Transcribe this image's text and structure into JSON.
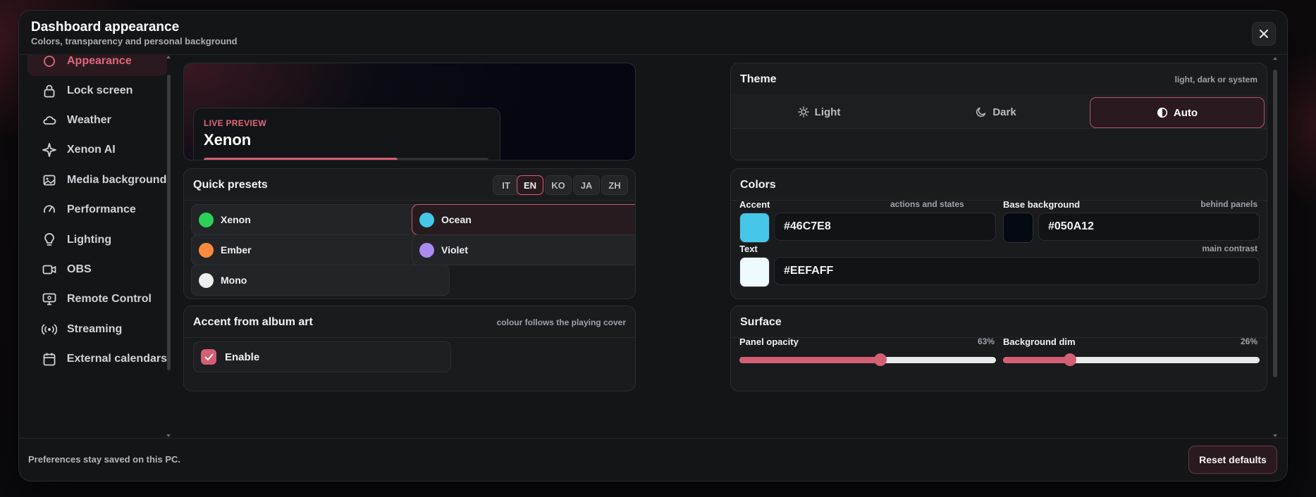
{
  "header": {
    "title": "Dashboard appearance",
    "subtitle": "Colors, transparency and personal background"
  },
  "sidebar": {
    "items": [
      {
        "label": "Appearance",
        "icon": "palette-icon",
        "active": true
      },
      {
        "label": "Lock screen",
        "icon": "lock-icon"
      },
      {
        "label": "Weather",
        "icon": "cloud-icon"
      },
      {
        "label": "Xenon AI",
        "icon": "sparkle-icon"
      },
      {
        "label": "Media background",
        "icon": "image-icon"
      },
      {
        "label": "Performance",
        "icon": "gauge-icon"
      },
      {
        "label": "Lighting",
        "icon": "bulb-icon"
      },
      {
        "label": "OBS",
        "icon": "video-icon"
      },
      {
        "label": "Remote Control",
        "icon": "monitor-icon"
      },
      {
        "label": "Streaming",
        "icon": "broadcast-icon"
      },
      {
        "label": "External calendars",
        "icon": "calendar-icon"
      }
    ]
  },
  "preview": {
    "label": "LIVE PREVIEW",
    "name": "Xenon",
    "progress": 0.68
  },
  "presets": {
    "title": "Quick presets",
    "languages": [
      "IT",
      "EN",
      "KO",
      "JA",
      "ZH"
    ],
    "active_language": "EN",
    "items": [
      {
        "label": "Xenon",
        "color": "#2ed158"
      },
      {
        "label": "Ocean",
        "color": "#46C7E8",
        "active": true
      },
      {
        "label": "Ember",
        "color": "#ff8a3d"
      },
      {
        "label": "Violet",
        "color": "#a98bf0"
      },
      {
        "label": "Mono",
        "color": "#eeeeee"
      }
    ]
  },
  "album": {
    "title": "Accent from album art",
    "hint": "colour follows the playing cover",
    "enable_label": "Enable",
    "enabled": true
  },
  "theme": {
    "title": "Theme",
    "hint": "light, dark or system",
    "options": [
      {
        "label": "Light",
        "icon": "sun-icon"
      },
      {
        "label": "Dark",
        "icon": "moon-icon"
      },
      {
        "label": "Auto",
        "icon": "half-circle-icon",
        "active": true
      }
    ]
  },
  "colors": {
    "title": "Colors",
    "accent": {
      "label": "Accent",
      "hint": "actions and states",
      "value": "#46C7E8"
    },
    "base": {
      "label": "Base background",
      "hint": "behind panels",
      "value": "#050A12"
    },
    "text": {
      "label": "Text",
      "hint": "main contrast",
      "value": "#EEFAFF"
    }
  },
  "surface": {
    "title": "Surface",
    "opacity": {
      "label": "Panel opacity",
      "value": "63%",
      "level": 0.55
    },
    "dim": {
      "label": "Background dim",
      "value": "26%",
      "level": 0.26
    }
  },
  "footer": {
    "note": "Preferences stay saved on this PC.",
    "reset_label": "Reset defaults"
  },
  "accent_color": "#d45f74"
}
